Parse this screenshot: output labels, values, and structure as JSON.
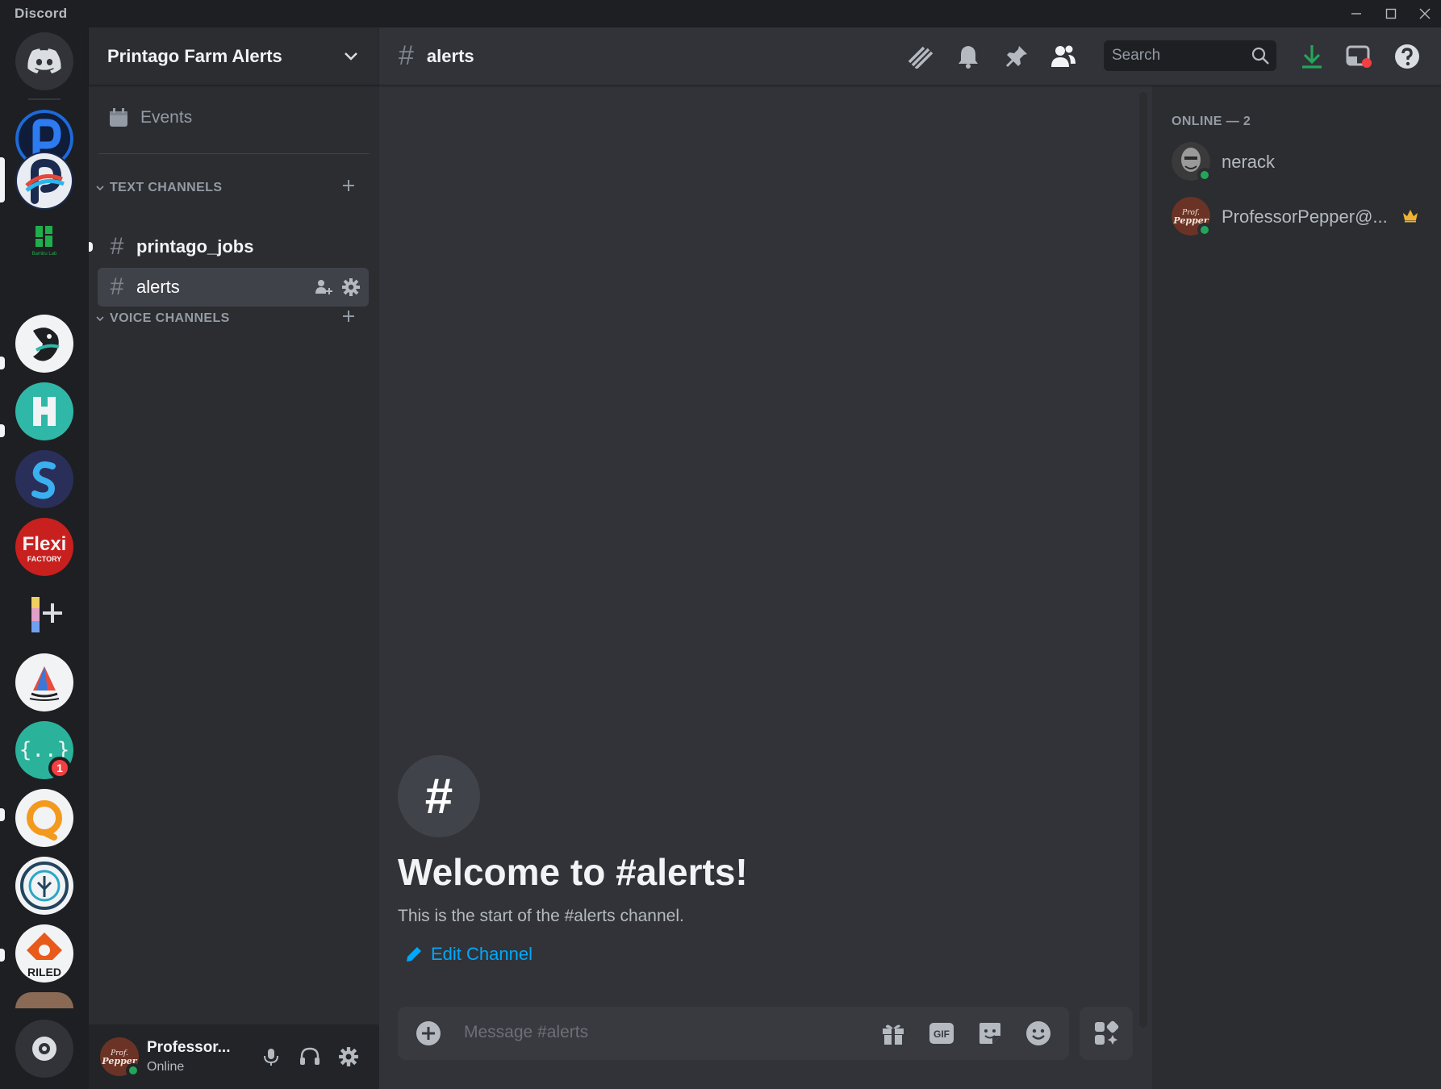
{
  "window": {
    "brand": "Discord"
  },
  "rail": {
    "servers": [
      {
        "name": "home-icon",
        "color": "#313338"
      },
      {
        "name": "printago-server-1",
        "color": "#0f1c3a"
      },
      {
        "name": "printago-server-2",
        "color": "#1c2a4a"
      },
      {
        "name": "bambu-lab-server",
        "color": "#1e1f22"
      },
      {
        "name": "server-bird",
        "color": "#f2f3f5"
      },
      {
        "name": "server-h",
        "color": "#2fb8a8"
      },
      {
        "name": "server-s",
        "color": "#2a2f5a"
      },
      {
        "name": "flexi-factory-server",
        "color": "#c8201e"
      },
      {
        "name": "server-color-plus",
        "color": "#1e1f22"
      },
      {
        "name": "server-sailboat",
        "color": "#f2f3f5"
      },
      {
        "name": "server-code",
        "color": "#2ab39a"
      },
      {
        "name": "server-orange-ring",
        "color": "#f2f3f5"
      },
      {
        "name": "server-tree",
        "color": "#f2f3f5"
      },
      {
        "name": "server-riled",
        "color": "#f2f3f5"
      }
    ],
    "badge_count": "1",
    "flexi_text": "Flexi",
    "flexi_sub": "FACTORY",
    "riled_text": "RILED",
    "bambu_text": "Bambu Lab"
  },
  "sidebar": {
    "guild_name": "Printago Farm Alerts",
    "events_label": "Events",
    "text_category": "TEXT CHANNELS",
    "voice_category": "VOICE CHANNELS",
    "channels": [
      {
        "label": "printago_jobs"
      },
      {
        "label": "alerts"
      }
    ]
  },
  "user_panel": {
    "name": "Professor...",
    "status": "Online"
  },
  "header": {
    "channel": "alerts",
    "search_placeholder": "Search"
  },
  "welcome": {
    "title": "Welcome to #alerts!",
    "subtitle": "This is the start of the #alerts channel.",
    "edit_label": "Edit Channel"
  },
  "composer": {
    "placeholder": "Message #alerts",
    "gif_label": "GIF"
  },
  "members": {
    "header": "ONLINE — 2",
    "list": [
      {
        "name": "nerack"
      },
      {
        "name": "ProfessorPepper@..."
      }
    ]
  },
  "colors": {
    "accent_link": "#00a8fc",
    "online": "#23a55a",
    "download": "#23a55a",
    "mention": "#f23f42",
    "crown": "#f0b232"
  }
}
